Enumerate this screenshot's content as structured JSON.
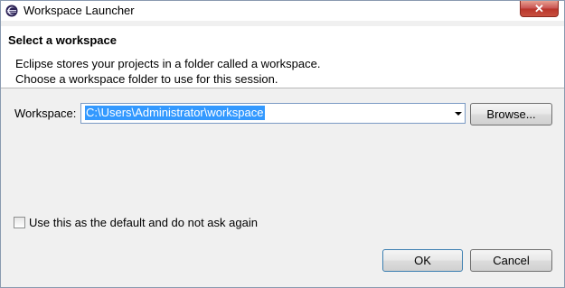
{
  "window": {
    "title": "Workspace Launcher",
    "close_glyph": "✕",
    "app_icon": "eclipse-icon"
  },
  "header": {
    "title": "Select a workspace",
    "message_line1": "Eclipse stores your projects in a folder called a workspace.",
    "message_line2": "Choose a workspace folder to use for this session."
  },
  "workspace": {
    "label": "Workspace:",
    "value": "C:\\Users\\Administrator\\workspace",
    "browse_label": "Browse..."
  },
  "default_option": {
    "label": "Use this as the default and do not ask again",
    "checked": false
  },
  "buttons": {
    "ok": "OK",
    "cancel": "Cancel"
  },
  "colors": {
    "selection": "#3399ff",
    "close_button": "#c75050"
  }
}
